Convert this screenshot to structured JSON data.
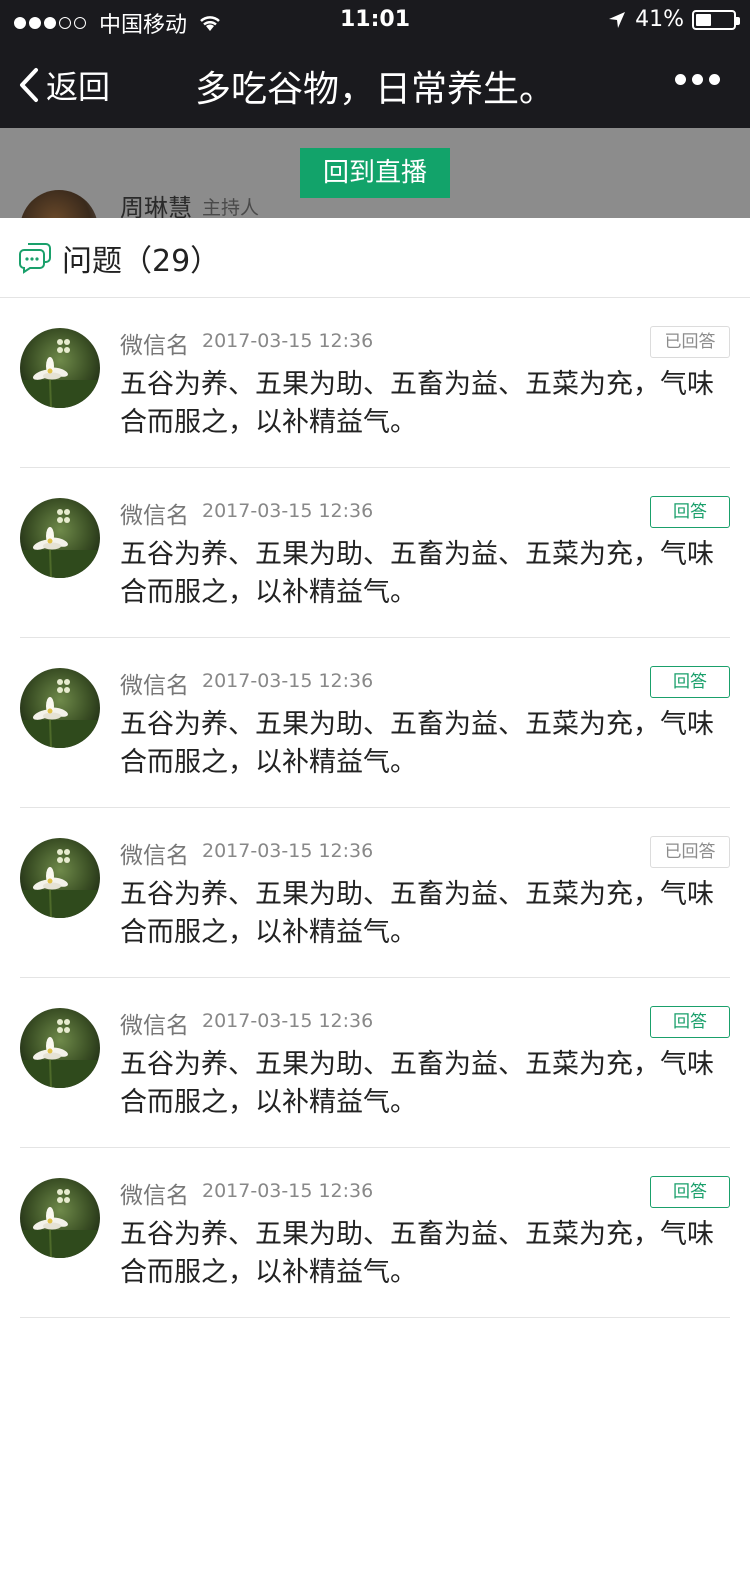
{
  "status_bar": {
    "carrier": "中国移动",
    "time": "11:01",
    "battery_text": "41%",
    "battery_level": 0.41
  },
  "nav": {
    "back_label": "返回",
    "title": "多吃谷物，日常养生。"
  },
  "host": {
    "name": "周琳慧",
    "role": "主持人"
  },
  "back_to_live_label": "回到直播",
  "questions_panel": {
    "title": "问题（29）",
    "items": [
      {
        "user": "微信名",
        "time": "2017-03-15 12:36",
        "status_label": "已回答",
        "answered": true,
        "text": "五谷为养、五果为助、五畜为益、五菜为充，气味合而服之，以补精益气。"
      },
      {
        "user": "微信名",
        "time": "2017-03-15 12:36",
        "status_label": "回答",
        "answered": false,
        "text": "五谷为养、五果为助、五畜为益、五菜为充，气味合而服之，以补精益气。"
      },
      {
        "user": "微信名",
        "time": "2017-03-15 12:36",
        "status_label": "回答",
        "answered": false,
        "text": "五谷为养、五果为助、五畜为益、五菜为充，气味合而服之，以补精益气。"
      },
      {
        "user": "微信名",
        "time": "2017-03-15 12:36",
        "status_label": "已回答",
        "answered": true,
        "text": "五谷为养、五果为助、五畜为益、五菜为充，气味合而服之，以补精益气。"
      },
      {
        "user": "微信名",
        "time": "2017-03-15 12:36",
        "status_label": "回答",
        "answered": false,
        "text": "五谷为养、五果为助、五畜为益、五菜为充，气味合而服之，以补精益气。"
      },
      {
        "user": "微信名",
        "time": "2017-03-15 12:36",
        "status_label": "回答",
        "answered": false,
        "text": "五谷为养、五果为助、五畜为益、五菜为充，气味合而服之，以补精益气。"
      }
    ]
  },
  "colors": {
    "accent": "#1aa06b",
    "bar_background": "#1a1a1e",
    "live_button": "#12a36a"
  }
}
